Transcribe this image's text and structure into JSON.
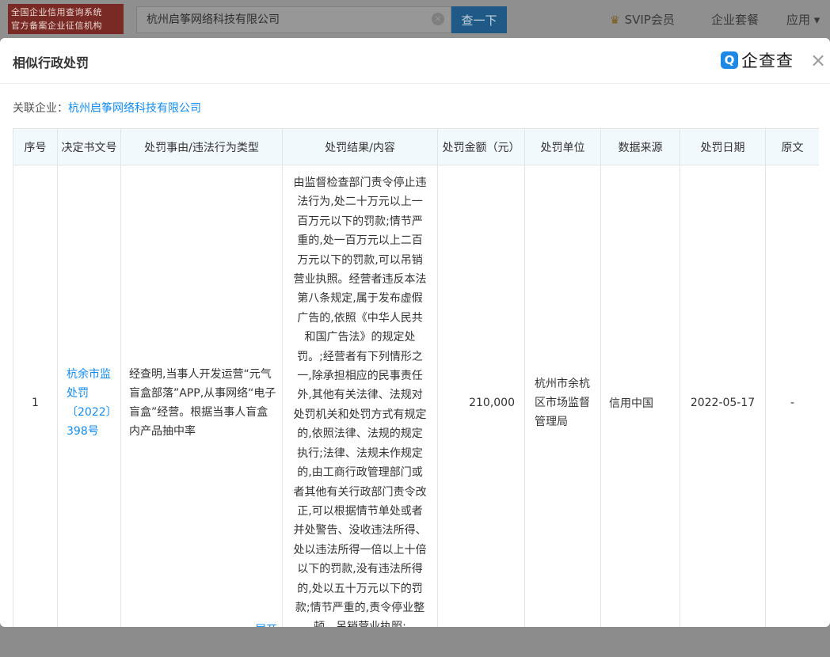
{
  "topbar": {
    "badge_line1": "全国企业信用查询系统",
    "badge_line2": "官方备案企业征信机构",
    "search_value": "杭州启筝网络科技有限公司",
    "search_button": "查一下",
    "svip": "SVIP会员",
    "enterprise": "企业套餐",
    "apps": "应用 ▾"
  },
  "modal": {
    "title": "相似行政处罚",
    "logo_mark": "Q",
    "logo_text": "企查查",
    "close_icon": "×",
    "related_label": "关联企业：",
    "related_company": "杭州启筝网络科技有限公司"
  },
  "table": {
    "headers": [
      "序号",
      "决定书文号",
      "处罚事由/违法行为类型",
      "处罚结果/内容",
      "处罚金额（元）",
      "处罚单位",
      "数据来源",
      "处罚日期",
      "原文"
    ],
    "rows": [
      {
        "index": "1",
        "doc_no": "杭余市监处罚〔2022〕398号",
        "reason": "经查明,当事人开发运营“元气盲盒部落”APP,从事网络“电子盲盒”经营。根据当事人盲盒内产品抽中率",
        "expand": "...展开",
        "result": "由监督检查部门责令停止违法行为,处二十万元以上一百万元以下的罚款;情节严重的,处一百万元以上二百万元以下的罚款,可以吊销营业执照。经营者违反本法第八条规定,属于发布虚假广告的,依照《中华人民共和国广告法》的规定处罚。;经营者有下列情形之一,除承担相应的民事责任外,其他有关法律、法规对处罚机关和处罚方式有规定的,依照法律、法规的规定执行;法律、法规未作规定的,由工商行政管理部门或者其他有关行政部门责令改正,可以根据情节单处或者并处警告、没收违法所得、处以违法所得一倍以上十倍以下的罚款,没有违法所得的,处以五十万元以下的罚款;情节严重的,责令停业整顿、吊销营业执照;",
        "amount": "210,000",
        "unit": "杭州市余杭区市场监督管理局",
        "source": "信用中国",
        "date": "2022-05-17",
        "original": "-"
      }
    ]
  }
}
